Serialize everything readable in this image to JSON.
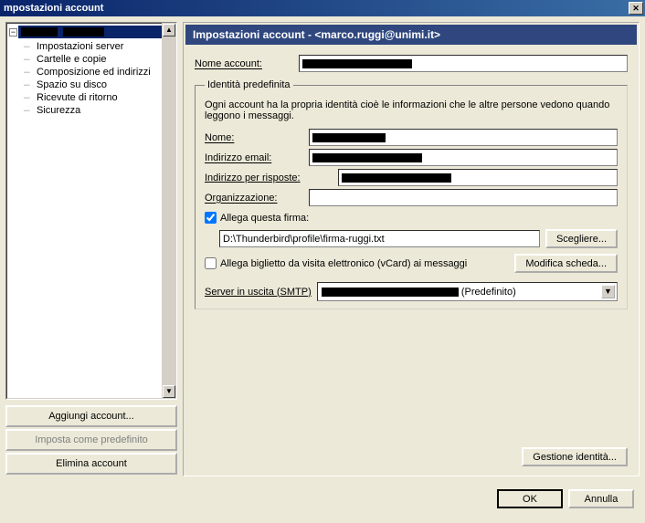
{
  "window": {
    "title": "mpostazioni account"
  },
  "sidebar": {
    "root_expander": "−",
    "items": [
      "Impostazioni server",
      "Cartelle e copie",
      "Composizione ed indirizzi",
      "Spazio su disco",
      "Ricevute di ritorno",
      "Sicurezza"
    ],
    "buttons": {
      "add": "Aggiungi account...",
      "set_default": "Imposta come predefinito",
      "remove": "Elimina account"
    }
  },
  "content": {
    "header_title": "Impostazioni account - <marco.ruggi@unimi.it>",
    "account_name_label": "Nome account:",
    "identity": {
      "legend": "Identità predefinita",
      "description": "Ogni account ha la propria identità cioè le informazioni che le altre persone vedono quando leggono i messaggi.",
      "name_label": "Nome:",
      "email_label": "Indirizzo email:",
      "replyto_label": "Indirizzo per risposte:",
      "org_label": "Organizzazione:",
      "attach_sig_label": "Allega questa firma:",
      "attach_sig_checked": true,
      "sig_path": "D:\\Thunderbird\\profile\\firma-ruggi.txt",
      "choose_btn": "Scegliere...",
      "vcard_label": "Allega biglietto da visita elettronico (vCard) ai messaggi",
      "vcard_checked": false,
      "edit_card_btn": "Modifica scheda...",
      "smtp_label": "Server in uscita (SMTP)",
      "smtp_value_suffix": "(Predefinito)"
    },
    "manage_identities_btn": "Gestione identità..."
  },
  "footer": {
    "ok": "OK",
    "cancel": "Annulla"
  }
}
